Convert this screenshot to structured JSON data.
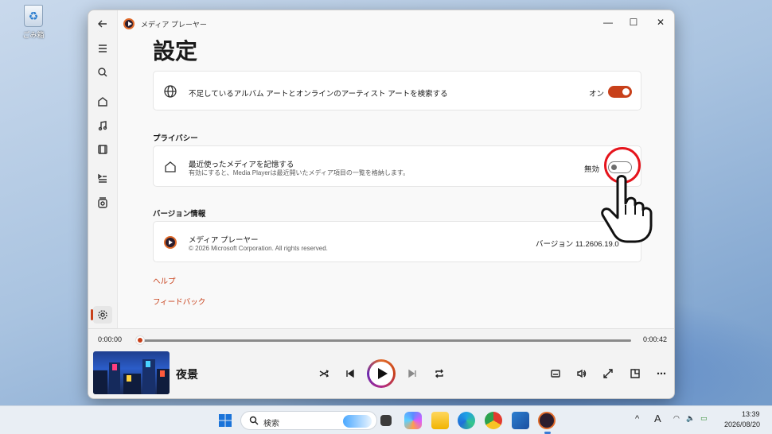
{
  "desktop": {
    "recycle_bin_label": "ごみ箱"
  },
  "window": {
    "app_title": "メディア プレーヤー",
    "controls": {
      "minimize": "—",
      "maximize": "☐",
      "close": "✕"
    }
  },
  "nav": {
    "items": [
      "back-icon",
      "menu-icon",
      "search-icon",
      "home-icon",
      "music-icon",
      "video-icon",
      "queue-icon",
      "playlist-icon",
      "settings-icon"
    ]
  },
  "settings": {
    "page_title": "設定",
    "album_art": {
      "label": "不足しているアルバム アートとオンラインのアーティスト アートを検索する",
      "state": "オン",
      "on": true
    },
    "privacy": {
      "heading": "プライバシー",
      "remember_media": {
        "label": "最近使ったメディアを記憶する",
        "description": "有効にすると、Media Playerは最近開いたメディア項目の一覧を格納します。",
        "state": "無効",
        "on": false
      }
    },
    "version": {
      "heading": "バージョン情報",
      "app_name": "メディア プレーヤー",
      "copyright": "© 2026 Microsoft Corporation. All rights reserved.",
      "version_text": "バージョン 11.2606.19.0"
    },
    "links": {
      "help": "ヘルプ",
      "feedback": "フィードバック"
    }
  },
  "player": {
    "elapsed": "0:00:00",
    "duration": "0:00:42",
    "progress": 0.0,
    "track_title": "夜景"
  },
  "taskbar": {
    "search_placeholder": "検索",
    "ime": "A",
    "clock_time": "13:39",
    "clock_date": "2026/08/20"
  },
  "colors": {
    "accent": "#c8401a",
    "highlight_ring": "#e5141c"
  }
}
